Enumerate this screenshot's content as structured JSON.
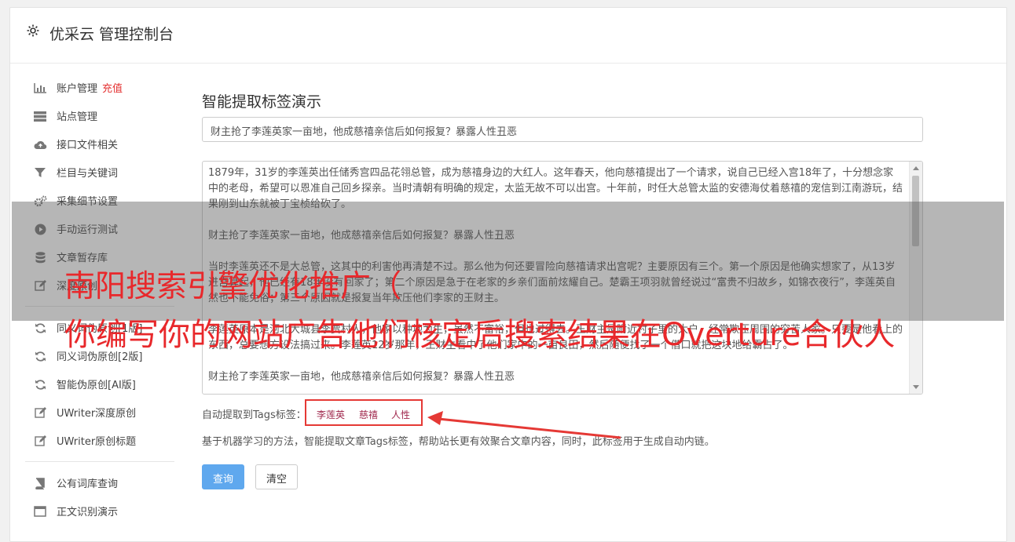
{
  "header": {
    "title": "优采云 管理控制台"
  },
  "sidebar": {
    "items": [
      {
        "label": "账户管理",
        "badge": "充值",
        "icon": "bar-chart-icon"
      },
      {
        "label": "站点管理",
        "icon": "server-icon"
      },
      {
        "label": "接口文件相关",
        "icon": "cloud-upload-icon"
      },
      {
        "label": "栏目与关键词",
        "icon": "filter-icon"
      },
      {
        "label": "采集细节设置",
        "icon": "gears-icon"
      },
      {
        "label": "手动运行测试",
        "icon": "play-circle-icon"
      },
      {
        "label": "文章暂存库",
        "icon": "database-icon"
      },
      {
        "label": "深度原创",
        "icon": "edit-icon"
      }
    ],
    "items2": [
      {
        "label": "同义词伪原创[1版]",
        "icon": "refresh-icon"
      },
      {
        "label": "同义词伪原创[2版]",
        "icon": "refresh-icon"
      },
      {
        "label": "智能伪原创[AI版]",
        "icon": "refresh-icon"
      },
      {
        "label": "UWriter深度原创",
        "icon": "edit-icon"
      },
      {
        "label": "UWriter原创标题",
        "icon": "edit-icon"
      }
    ],
    "items3": [
      {
        "label": "公有词库查询",
        "icon": "book-icon"
      },
      {
        "label": "正文识别演示",
        "icon": "window-icon"
      }
    ]
  },
  "main": {
    "heading": "智能提取标签演示",
    "title_value": "财主抢了李莲英家一亩地，他成慈禧亲信后如何报复？暴露人性丑恶",
    "content_paragraphs": [
      "1879年，31岁的李莲英出任储秀宫四品花翎总管，成为慈禧身边的大红人。这年春天，他向慈禧提出了一个请求，说自己已经入宫18年了，十分想念家中的老母，希望可以恩准自己回乡探亲。当时清朝有明确的规定，太监无故不可以出宫。十年前，时任大总管太监的安德海仗着慈禧的宠信到江南游玩，结果刚到山东就被丁宝桢给砍了。",
      "财主抢了李莲英家一亩地，他成慈禧亲信后如何报复？暴露人性丑恶",
      "当时李莲英还不是大总管，这其中的利害他再清楚不过。那么他为何还要冒险向慈禧请求出宫呢？主要原因有三个。第一个原因是他确实想家了，从13岁进宫算起，他已经有18年没有回家了；第二个原因是急于在老家的乡亲们面前炫耀自己。楚霸王项羽就曾经说过“富贵不归故乡，如锦衣夜行”，李莲英自然也不能免俗；第三个原因就是报复当年欺压他们李家的王财主。",
      "李莲英原本是河北大城县李贾村人，他家以种地为生，虽然不富裕，但也过得去。王财主是附近村子里的大户，经常欺压周围的穷苦人家。只要是他看上的东西，总要想方设法搞过来。李莲英12岁那年，王财主看中了他们家中的一亩良田，然后随便找了一个借口就把这块地给霸占了。",
      "财主抢了李莲英家一亩地，他成慈禧亲信后如何报复？暴露人性丑恶"
    ],
    "tags_label": "自动提取到Tags标签：",
    "tags": [
      "李莲英",
      "慈禧",
      "人性"
    ],
    "description": "基于机器学习的方法，智能提取文章Tags标签，帮助站长更有效聚合文章内容，同时，此标签用于生成自动内链。",
    "query_button": "查询",
    "clear_button": "清空"
  },
  "overlay": {
    "line1": "南阳搜索引擎优化推广（",
    "line2": "你编写你的网站广告他们核定后搜索结果在Overture合伙人"
  },
  "colors": {
    "accent": "#5fa8ee",
    "badge": "#e43333",
    "tag": "#a0284d",
    "overlay_text": "#e8282b",
    "highlight_border": "#e53935"
  }
}
